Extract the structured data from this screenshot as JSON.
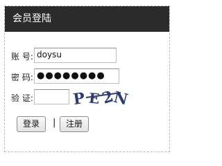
{
  "panel": {
    "title": "会员登陆"
  },
  "form": {
    "account": {
      "label": "账 号:",
      "value": "doysu"
    },
    "password": {
      "label": "密 码:",
      "value": "●●●●●●●●"
    },
    "verify": {
      "label": "验 证:",
      "value": ""
    },
    "captcha": {
      "text": "PE2N"
    }
  },
  "buttons": {
    "login": "登录",
    "separator": "|",
    "register": "注册"
  },
  "colors": {
    "header_bg": "#2b2b2b",
    "header_text": "#ffffff",
    "captcha_text": "#2f3a6e"
  }
}
